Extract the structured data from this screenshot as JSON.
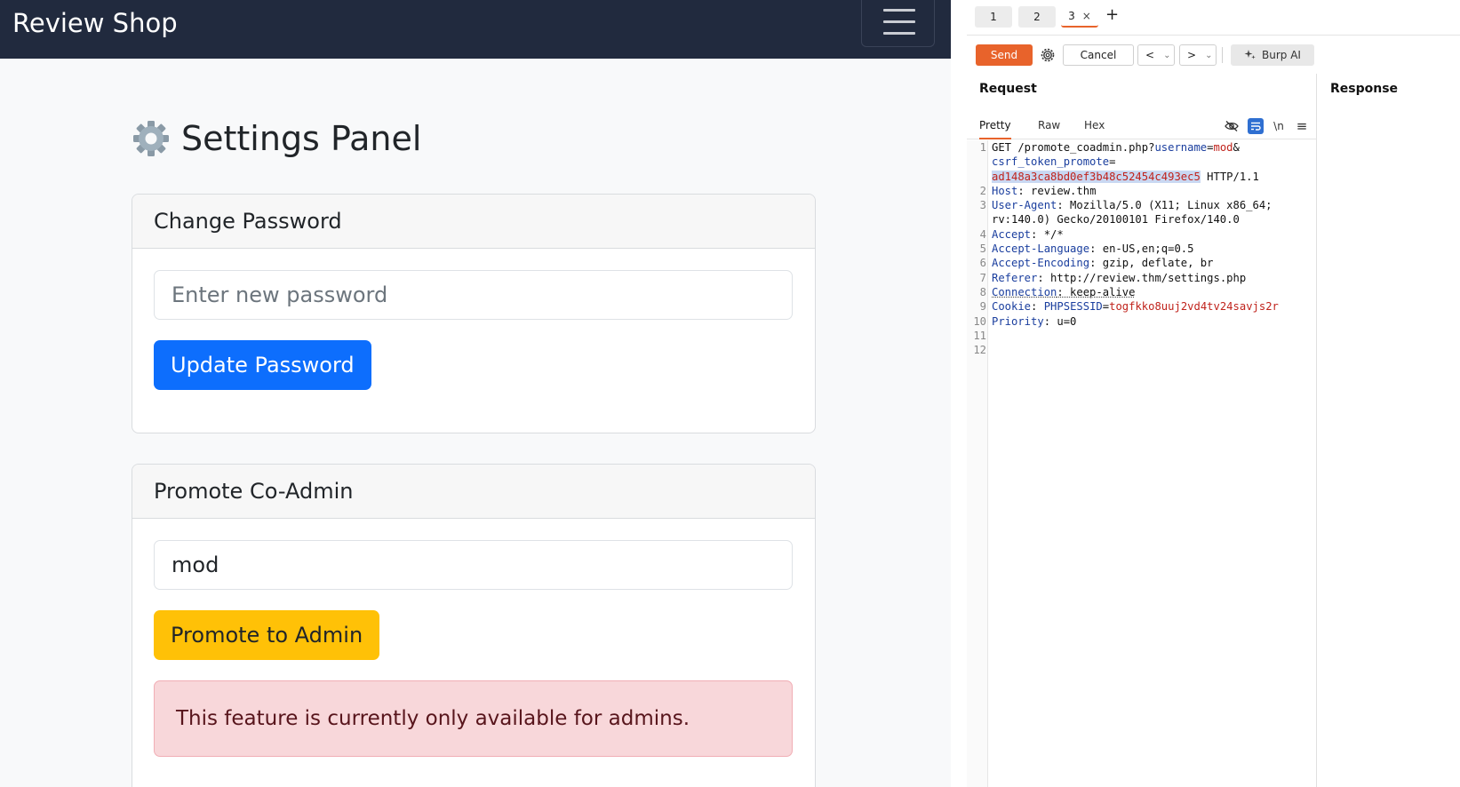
{
  "site": {
    "brand": "Review Shop",
    "page_title": "Settings Panel",
    "change_password": {
      "header": "Change Password",
      "input_placeholder": "Enter new password",
      "button": "Update Password"
    },
    "promote": {
      "header": "Promote Co-Admin",
      "input_value": "mod",
      "button": "Promote to Admin",
      "alert": "This feature is currently only available for admins."
    }
  },
  "burp": {
    "tabs": [
      "1",
      "2",
      "3"
    ],
    "tab_close": "×",
    "tab_add": "+",
    "toolbar": {
      "send": "Send",
      "cancel": "Cancel",
      "prev": "<",
      "next": ">",
      "dropdown": "⌄",
      "burp_ai": "Burp AI"
    },
    "request_title": "Request",
    "response_title": "Response",
    "subtabs": [
      "Pretty",
      "Raw",
      "Hex"
    ],
    "subtab_icons": {
      "hide": "hide-icon",
      "wrap": "wrap-icon",
      "newline": "\\n",
      "menu": "≡"
    },
    "request_lines": {
      "l1a": "GET /promote_coadmin.php?",
      "l1_key": "username",
      "l1_eq": "=",
      "l1_val": "mod",
      "l1_amp": "&",
      "l1b_key": "csrf_token_promote",
      "l1b_eq": "=",
      "l1c_val": "ad148a3ca8bd0ef3b48c52454c493ec5",
      "l1c_rest": " HTTP/1.1",
      "l2_key": "Host",
      "l2_val": ": review.thm",
      "l3_key": "User-Agent",
      "l3_val": ": Mozilla/5.0 (X11; Linux x86_64;",
      "l3b": "rv:140.0) Gecko/20100101 Firefox/140.0",
      "l4_key": "Accept",
      "l4_val": ": */*",
      "l5_key": "Accept-Language",
      "l5_val": ": en-US,en;q=0.5",
      "l6_key": "Accept-Encoding",
      "l6_val": ": gzip, deflate, br",
      "l7_key": "Referer",
      "l7_val": ": http://review.thm/settings.php",
      "l8_key": "Connection",
      "l8_val": ": keep-alive",
      "l9_key": "Cookie",
      "l9_sep": ": ",
      "l9_ck": "PHPSESSID",
      "l9_eq": "=",
      "l9_val": "togfkko8uuj2vd4tv24savjs2r",
      "l10_key": "Priority",
      "l10_val": ": u=0"
    },
    "line_numbers": [
      "1",
      "2",
      "3",
      "4",
      "5",
      "6",
      "7",
      "8",
      "9",
      "10",
      "11",
      "12"
    ]
  },
  "colors": {
    "navbar": "#212a3e",
    "primary": "#0d6efd",
    "warning": "#ffc107",
    "alert_bg": "#f8d7da",
    "burp_accent": "#e8632b",
    "burp_blue": "#2f6fd1"
  }
}
